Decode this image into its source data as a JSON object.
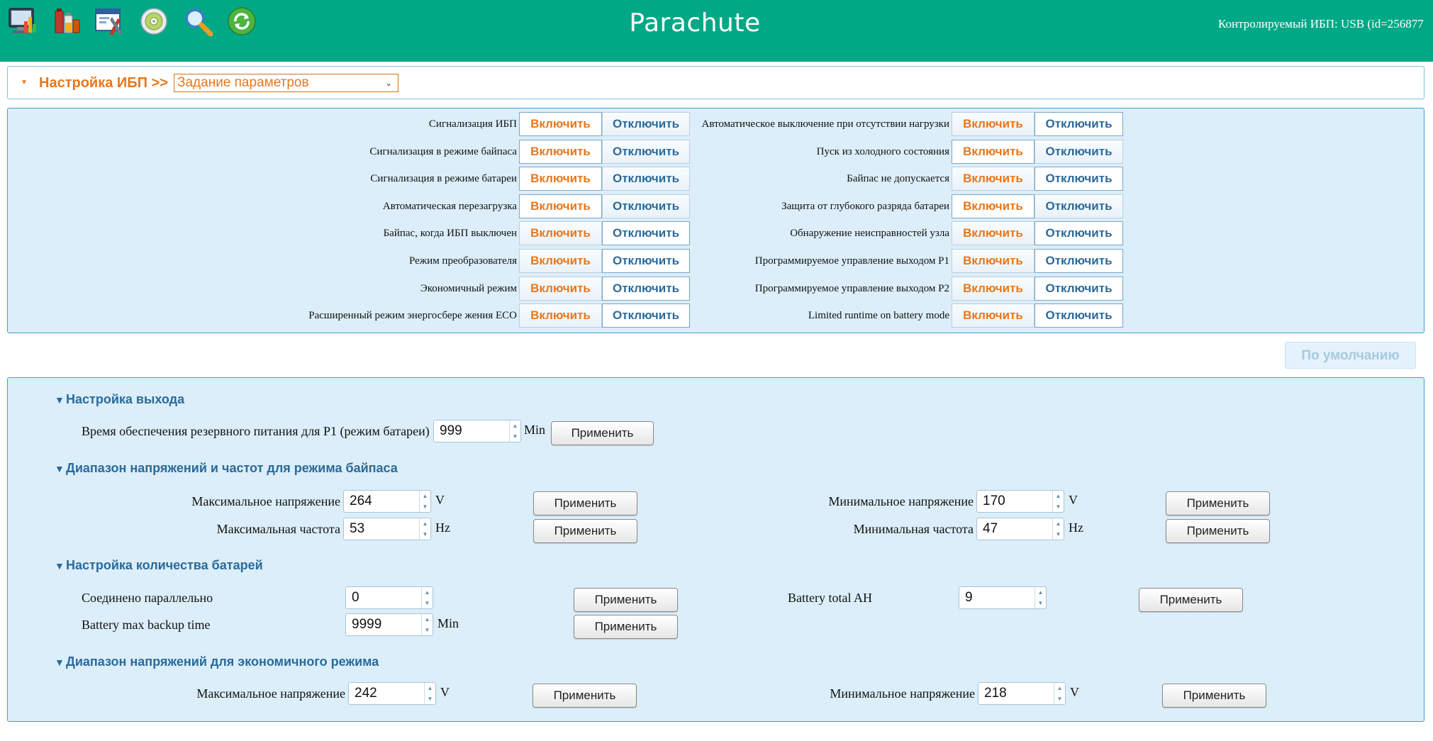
{
  "header": {
    "brand": "Parachute",
    "monitored_ups": "Контролируемый ИБП: USB (id=256877",
    "icons": [
      "monitor-chart-icon",
      "battery-bars-icon",
      "settings-tools-icon",
      "cd-disc-icon",
      "magnifier-icon",
      "refresh-icon"
    ],
    "bg_color": "#00a886"
  },
  "titlebar": {
    "label": "Настройка ИБП >>",
    "select_value": "Задание параметров"
  },
  "options": {
    "on_label": "Включить",
    "off_label": "Отключить",
    "left": [
      {
        "label": "Сигнализация ИБП",
        "state": "on"
      },
      {
        "label": "Сигнализация в режиме байпаса",
        "state": "on"
      },
      {
        "label": "Сигнализация в режиме батареи",
        "state": "on"
      },
      {
        "label": "Автоматическая перезагрузка",
        "state": "on"
      },
      {
        "label": "Байпас, когда ИБП выключен",
        "state": "off"
      },
      {
        "label": "Режим преобразователя",
        "state": "off"
      },
      {
        "label": "Экономичный режим",
        "state": "off"
      },
      {
        "label": "Расширенный режим энергосбере жения ECO",
        "state": "off"
      }
    ],
    "right": [
      {
        "label": "Автоматическое выключение при отсутствии нагрузки",
        "state": "off"
      },
      {
        "label": "Пуск из холодного состояния",
        "state": "on"
      },
      {
        "label": "Байпас не допускается",
        "state": "off"
      },
      {
        "label": "Защита от глубокого разряда батареи",
        "state": "on"
      },
      {
        "label": "Обнаружение неисправностей узла",
        "state": "off"
      },
      {
        "label": "Программируемое управление выходом P1",
        "state": "off"
      },
      {
        "label": "Программируемое управление выходом P2",
        "state": "off"
      },
      {
        "label": "Limited runtime on battery mode",
        "state": "off"
      }
    ],
    "default_button": "По умолчанию"
  },
  "settings": {
    "apply_label": "Применить",
    "output": {
      "title": "Настройка выхода",
      "backup_label": "Время обеспечения резервного питания для P1 (режим батареи)",
      "backup_value": "999",
      "backup_unit": "Min"
    },
    "bypass": {
      "title": "Диапазон напряжений и частот для режима байпаса",
      "max_voltage_label": "Максимальное напряжение",
      "max_voltage_value": "264",
      "max_voltage_unit": "V",
      "max_freq_label": "Максимальная частота",
      "max_freq_value": "53",
      "max_freq_unit": "Hz",
      "min_voltage_label": "Минимальное напряжение",
      "min_voltage_value": "170",
      "min_voltage_unit": "V",
      "min_freq_label": "Минимальная частота",
      "min_freq_value": "47",
      "min_freq_unit": "Hz"
    },
    "battery": {
      "title": "Настройка количества батарей",
      "parallel_label": "Соединено параллельно",
      "parallel_value": "0",
      "total_ah_label": "Battery total AH",
      "total_ah_value": "9",
      "max_backup_label": "Battery max backup time",
      "max_backup_value": "9999",
      "max_backup_unit": "Min"
    },
    "eco": {
      "title": "Диапазон напряжений для экономичного режима",
      "max_voltage_label": "Максимальное напряжение",
      "max_voltage_value": "242",
      "max_voltage_unit": "V",
      "min_voltage_label": "Минимальное напряжение",
      "min_voltage_value": "218",
      "min_voltage_unit": "V"
    }
  },
  "colors": {
    "accent_orange": "#e8771b",
    "accent_blue": "#2b6a9a",
    "panel_bg": "#dbeef9",
    "panel_border": "#3aa0d9"
  }
}
